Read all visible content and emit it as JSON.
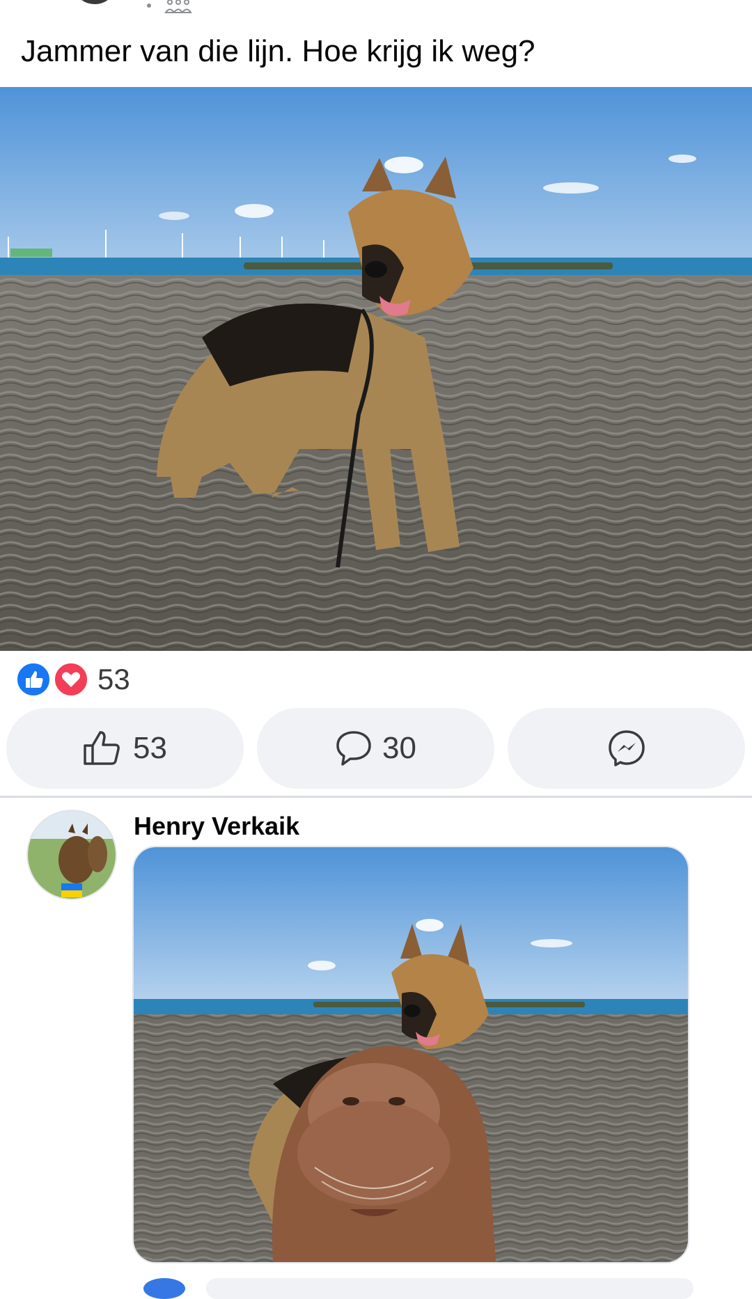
{
  "post": {
    "text": "Jammer van die lijn. Hoe krijg ik weg?",
    "image_desc": "German shepherd standing on a rippled sandy beach, sea and wind turbines in the background",
    "audience_icon": "group-icon"
  },
  "reactions": {
    "icons": [
      "like-icon",
      "love-icon"
    ],
    "count": "53"
  },
  "actions": {
    "like_count": "53",
    "comment_count": "30"
  },
  "comment": {
    "author": "Henry Verkaik",
    "image_desc": "Edited photo of the same German shepherd with a walrus face covering the leash line"
  },
  "colors": {
    "like_blue": "#1877f2",
    "love_red": "#f33e58",
    "button_bg": "#f0f2f5",
    "divider": "#dadde1"
  }
}
